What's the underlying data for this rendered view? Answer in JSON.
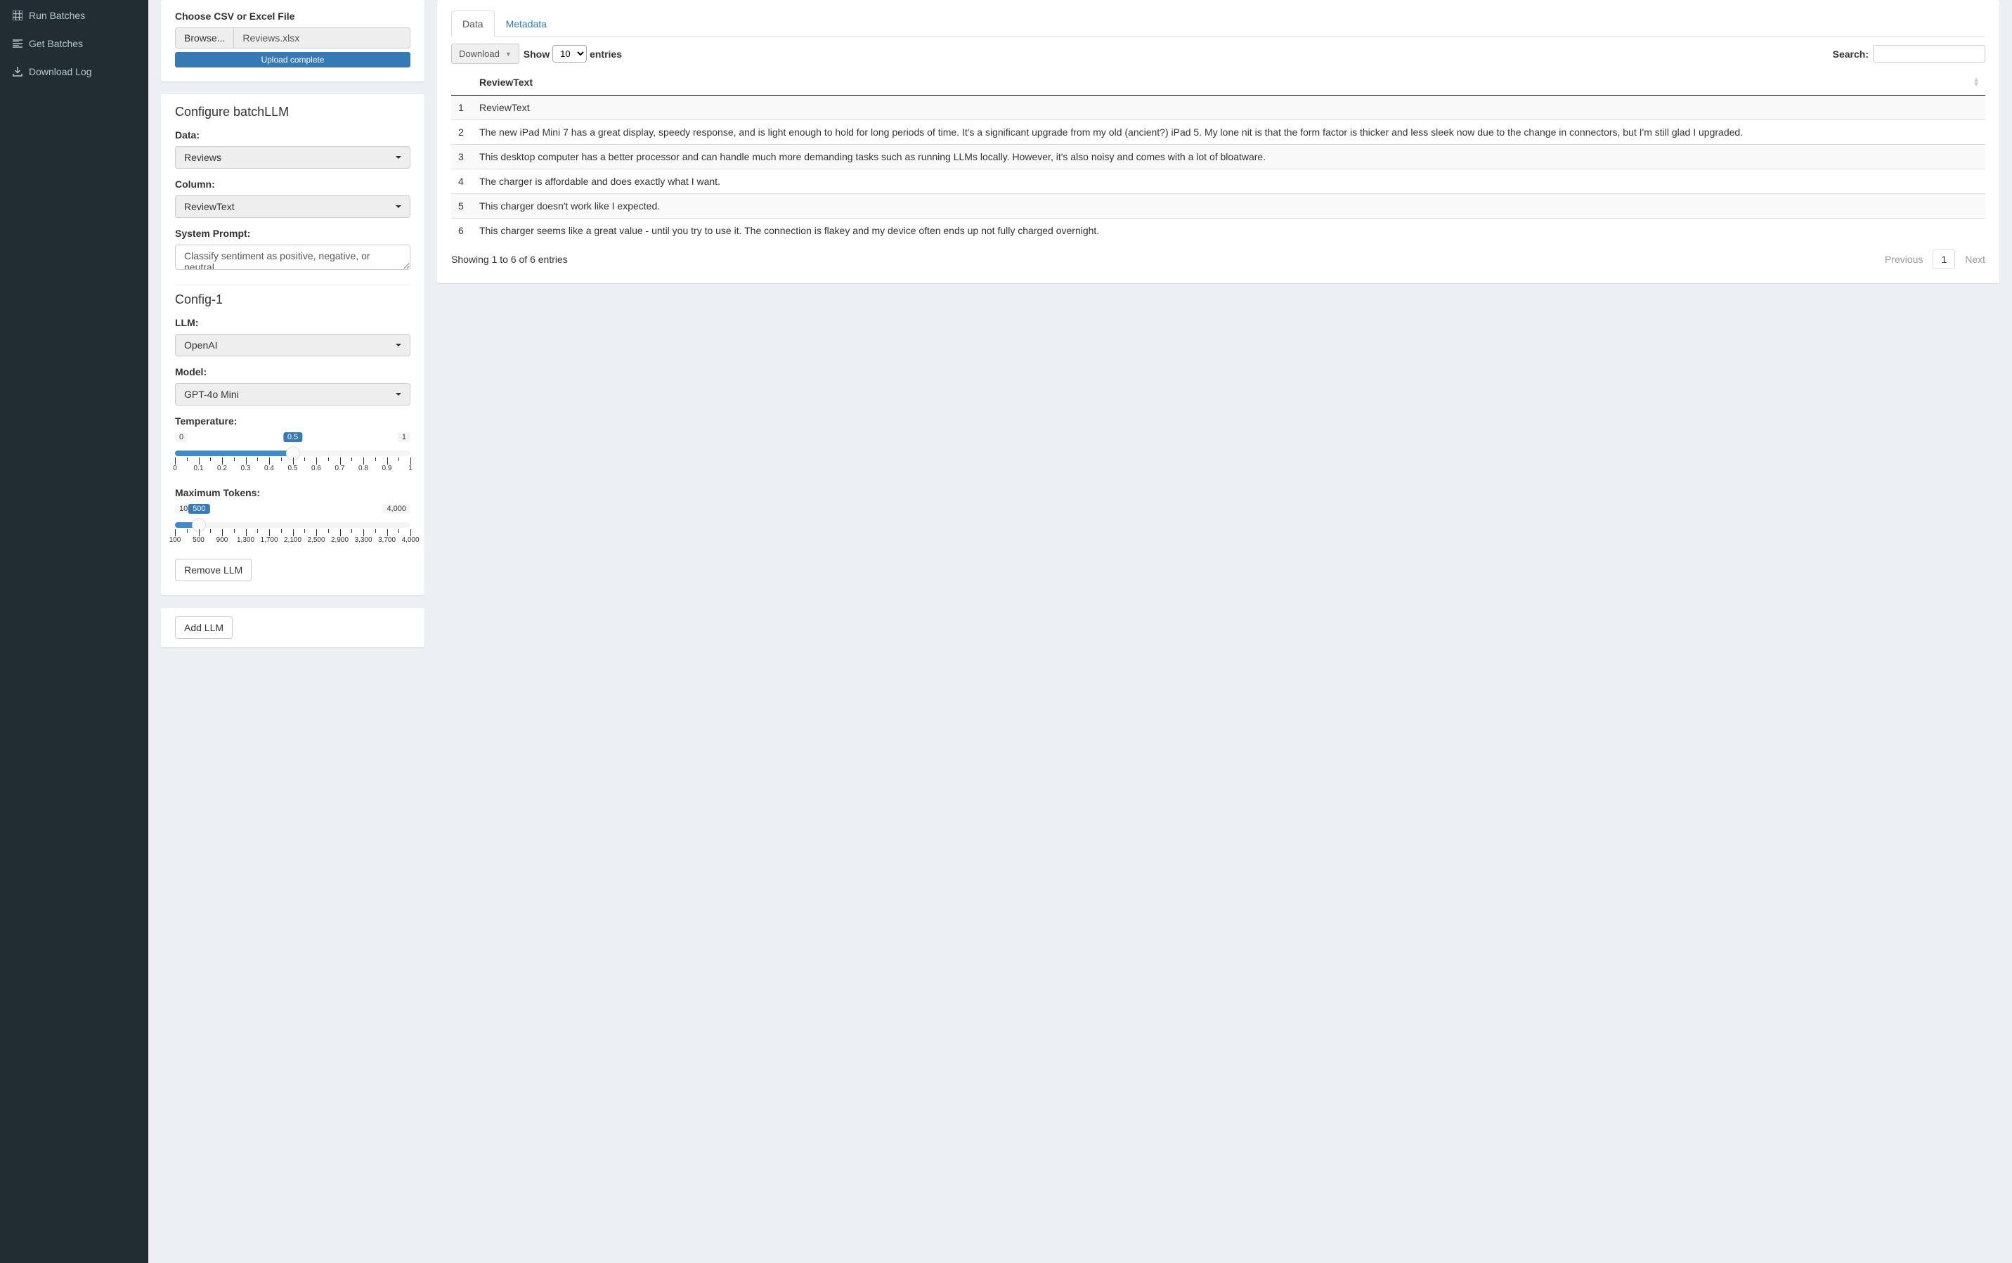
{
  "sidebar": {
    "items": [
      {
        "label": "Run Batches",
        "icon": "table-icon"
      },
      {
        "label": "Get Batches",
        "icon": "list-icon"
      },
      {
        "label": "Download Log",
        "icon": "download-icon"
      }
    ]
  },
  "upload": {
    "label": "Choose CSV or Excel File",
    "browse": "Browse...",
    "filename": "Reviews.xlsx",
    "status": "Upload complete"
  },
  "config": {
    "heading": "Configure batchLLM",
    "data_label": "Data:",
    "data_value": "Reviews",
    "column_label": "Column:",
    "column_value": "ReviewText",
    "prompt_label": "System Prompt:",
    "prompt_value": "Classify sentiment as positive, negative, or neutral",
    "config_name": "Config-1",
    "llm_label": "LLM:",
    "llm_value": "OpenAI",
    "model_label": "Model:",
    "model_value": "GPT-4o Mini",
    "temp_label": "Temperature:",
    "temp": {
      "min": "0",
      "max": "1",
      "value": "0.5",
      "pct": 50,
      "ticks": [
        "0",
        "0.1",
        "0.2",
        "0.3",
        "0.4",
        "0.5",
        "0.6",
        "0.7",
        "0.8",
        "0.9",
        "1"
      ]
    },
    "tokens_label": "Maximum Tokens:",
    "tokens": {
      "min": "100",
      "max": "4,000",
      "value": "500",
      "pct": 10.26,
      "ticks": [
        "100",
        "500",
        "900",
        "1,300",
        "1,700",
        "2,100",
        "2,500",
        "2,900",
        "3,300",
        "3,700",
        "4,000"
      ]
    },
    "remove_btn": "Remove LLM",
    "add_btn": "Add LLM"
  },
  "table": {
    "tabs": {
      "data": "Data",
      "metadata": "Metadata"
    },
    "download": "Download",
    "show": "Show",
    "show_value": "10",
    "entries": "entries",
    "search_label": "Search:",
    "header": "ReviewText",
    "rows": [
      {
        "n": "1",
        "text": "ReviewText"
      },
      {
        "n": "2",
        "text": "The new iPad Mini 7 has a great display, speedy response, and is light enough to hold for long periods of time. It's a significant upgrade from my old (ancient?) iPad 5. My lone nit is that the form factor is thicker and less sleek now due to the change in connectors, but I'm still glad I upgraded."
      },
      {
        "n": "3",
        "text": "This desktop computer has a better processor and can handle much more demanding tasks such as running LLMs locally. However, it's also noisy and comes with a lot of bloatware."
      },
      {
        "n": "4",
        "text": "The charger is affordable and does exactly what I want."
      },
      {
        "n": "5",
        "text": "This charger doesn't work like I expected."
      },
      {
        "n": "6",
        "text": "This charger seems like a great value - until you try to use it. The connection is flakey and my device often ends up not fully charged overnight."
      }
    ],
    "info": "Showing 1 to 6 of 6 entries",
    "prev": "Previous",
    "page": "1",
    "next": "Next"
  }
}
